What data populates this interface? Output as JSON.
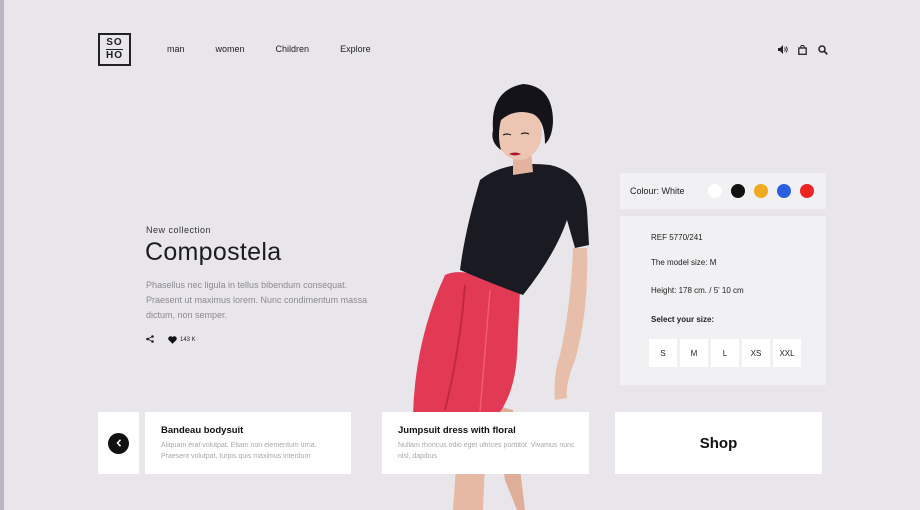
{
  "brand": {
    "logo_top": "SO",
    "logo_bottom": "HO"
  },
  "nav": {
    "items": [
      "man",
      "women",
      "Children",
      "Explore"
    ]
  },
  "header_icons": [
    "speaker-icon",
    "bag-icon",
    "search-icon"
  ],
  "hero": {
    "eyebrow": "New collection",
    "title": "Compostela",
    "description": "Phasellus nec ligula in tellus bibendum consequat. Praesent ut maximus lorem. Nunc condimentum massa dictum, non semper.",
    "likes": "143 K"
  },
  "colour": {
    "label": "Colour: White",
    "swatches": [
      "#ffffff",
      "#111111",
      "#f0a920",
      "#2a5fe0",
      "#ee2424"
    ]
  },
  "details": {
    "ref": "REF 5770/241",
    "model_size": "The model  size: M",
    "height": "Height: 178 cm. / 5' 10 cm",
    "select_size": "Select your size:",
    "sizes": [
      "S",
      "M",
      "L",
      "XS",
      "XXL"
    ]
  },
  "cards": [
    {
      "title": "Bandeau bodysuit",
      "desc": "Aliquam erat volutpat. Etiam non elementum urna. Praesent volutpat, turpis quis maximus interdum"
    },
    {
      "title": "Jumpsuit dress with floral",
      "desc": "Nullam rhoncus odio eget ultrices porttitor. Vivamus nunc nisl, dapibus"
    }
  ],
  "shop": {
    "label": "Shop"
  }
}
